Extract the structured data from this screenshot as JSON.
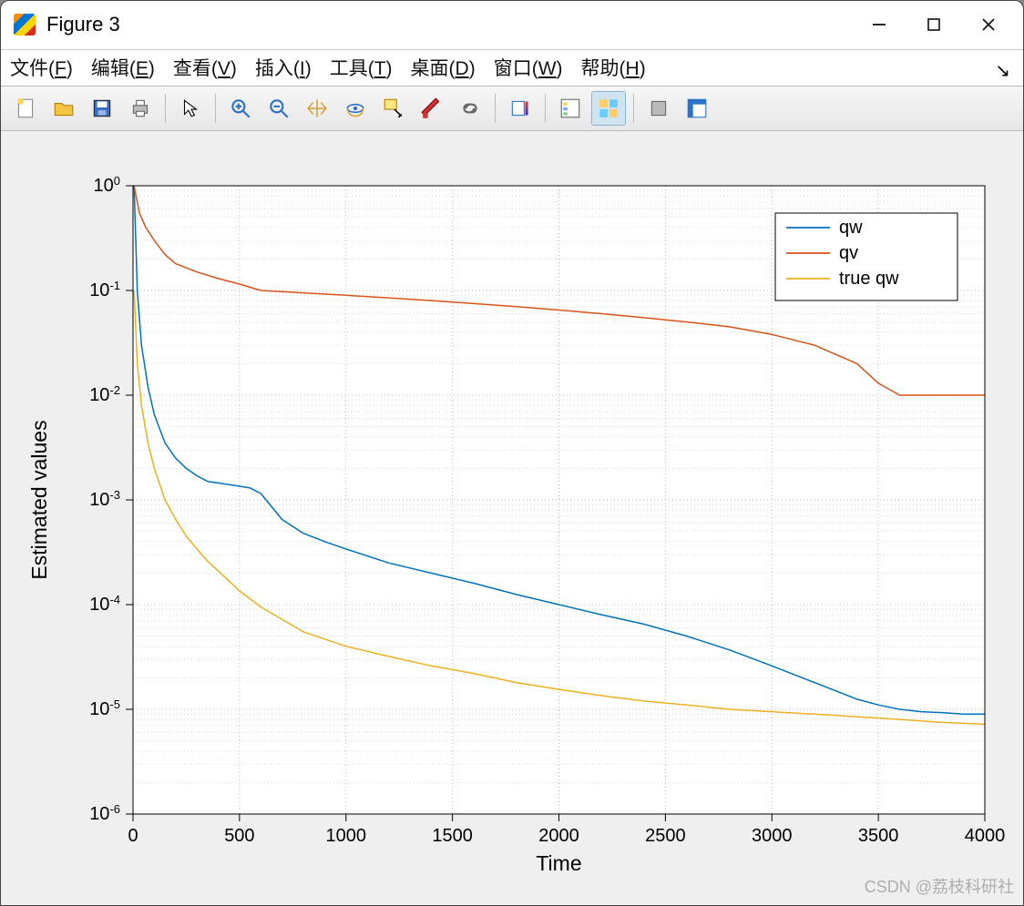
{
  "window": {
    "title": "Figure 3",
    "minimize_icon": "minimize-icon",
    "maximize_icon": "maximize-icon",
    "close_icon": "close-icon"
  },
  "menubar": {
    "items": [
      {
        "label": "文件(",
        "mnemonic": "F",
        "suffix": ")"
      },
      {
        "label": "编辑(",
        "mnemonic": "E",
        "suffix": ")"
      },
      {
        "label": "查看(",
        "mnemonic": "V",
        "suffix": ")"
      },
      {
        "label": "插入(",
        "mnemonic": "I",
        "suffix": ")"
      },
      {
        "label": "工具(",
        "mnemonic": "T",
        "suffix": ")"
      },
      {
        "label": "桌面(",
        "mnemonic": "D",
        "suffix": ")"
      },
      {
        "label": "窗口(",
        "mnemonic": "W",
        "suffix": ")"
      },
      {
        "label": "帮助(",
        "mnemonic": "H",
        "suffix": ")"
      }
    ]
  },
  "toolbar": {
    "buttons": [
      "new-figure-icon",
      "open-icon",
      "save-icon",
      "print-icon",
      "|",
      "pointer-icon",
      "|",
      "zoom-in-icon",
      "zoom-out-icon",
      "pan-icon",
      "rotate-3d-icon",
      "data-cursor-icon",
      "brush-icon",
      "link-icon",
      "|",
      "colorbar-icon",
      "|",
      "insert-legend-icon",
      "plot-tools-icon",
      "|",
      "hide-tools-icon",
      "show-plot-tools-icon"
    ],
    "active": "plot-tools-icon"
  },
  "watermark": "CSDN @荔枝科研社",
  "chart_data": {
    "type": "line",
    "xlabel": "Time",
    "ylabel": "Estimated values",
    "xlim": [
      0,
      4000
    ],
    "ylim": [
      1e-06,
      1
    ],
    "yscale": "log",
    "xticks": [
      0,
      500,
      1000,
      1500,
      2000,
      2500,
      3000,
      3500,
      4000
    ],
    "yticks_exp": [
      0,
      -1,
      -2,
      -3,
      -4,
      -5,
      -6
    ],
    "yticks_labels": [
      "10^0",
      "10^-1",
      "10^-2",
      "10^-3",
      "10^-4",
      "10^-5",
      "10^-6"
    ],
    "legend": {
      "position": "northeast",
      "entries": [
        "qw",
        "qv",
        "true qw"
      ]
    },
    "colors": {
      "qw": "#0072BD",
      "qv": "#D95319",
      "true_qw": "#EDB120"
    },
    "grid": true,
    "series": [
      {
        "name": "qw",
        "x": [
          5,
          20,
          40,
          70,
          100,
          150,
          200,
          250,
          300,
          350,
          400,
          450,
          500,
          550,
          600,
          700,
          800,
          900,
          1000,
          1200,
          1400,
          1600,
          1800,
          2000,
          2200,
          2400,
          2600,
          2800,
          3000,
          3200,
          3400,
          3500,
          3600,
          3700,
          3800,
          3900,
          4000
        ],
        "y": [
          1.0,
          0.1,
          0.03,
          0.012,
          0.0065,
          0.0035,
          0.0025,
          0.002,
          0.0017,
          0.0015,
          0.00145,
          0.0014,
          0.00135,
          0.0013,
          0.00115,
          0.00065,
          0.00048,
          0.0004,
          0.00034,
          0.00025,
          0.0002,
          0.00016,
          0.000125,
          0.0001,
          8e-05,
          6.5e-05,
          5e-05,
          3.7e-05,
          2.6e-05,
          1.8e-05,
          1.25e-05,
          1.1e-05,
          1e-05,
          9.5e-06,
          9.3e-06,
          9e-06,
          9e-06
        ]
      },
      {
        "name": "qv",
        "x": [
          5,
          30,
          60,
          100,
          150,
          200,
          300,
          400,
          500,
          600,
          800,
          1000,
          1200,
          1400,
          1600,
          1800,
          2000,
          2200,
          2400,
          2600,
          2800,
          3000,
          3200,
          3400,
          3500,
          3600,
          3700,
          3800,
          3900,
          4000
        ],
        "y": [
          1.0,
          0.55,
          0.4,
          0.3,
          0.22,
          0.18,
          0.15,
          0.13,
          0.115,
          0.1,
          0.095,
          0.09,
          0.085,
          0.08,
          0.075,
          0.07,
          0.065,
          0.06,
          0.055,
          0.05,
          0.045,
          0.038,
          0.03,
          0.02,
          0.013,
          0.01,
          0.01,
          0.01,
          0.01,
          0.01
        ]
      },
      {
        "name": "true qw",
        "x": [
          5,
          20,
          40,
          70,
          100,
          150,
          200,
          250,
          300,
          350,
          400,
          500,
          600,
          800,
          1000,
          1200,
          1400,
          1600,
          1800,
          2000,
          2200,
          2400,
          2600,
          2800,
          3000,
          3200,
          3400,
          3600,
          3800,
          4000
        ],
        "y": [
          0.1,
          0.02,
          0.008,
          0.0035,
          0.002,
          0.001,
          0.00065,
          0.00045,
          0.00034,
          0.00026,
          0.00021,
          0.000135,
          9.5e-05,
          5.5e-05,
          4e-05,
          3.2e-05,
          2.6e-05,
          2.2e-05,
          1.8e-05,
          1.55e-05,
          1.35e-05,
          1.2e-05,
          1.1e-05,
          1e-05,
          9.5e-06,
          9e-06,
          8.5e-06,
          8e-06,
          7.5e-06,
          7.2e-06
        ]
      }
    ]
  }
}
